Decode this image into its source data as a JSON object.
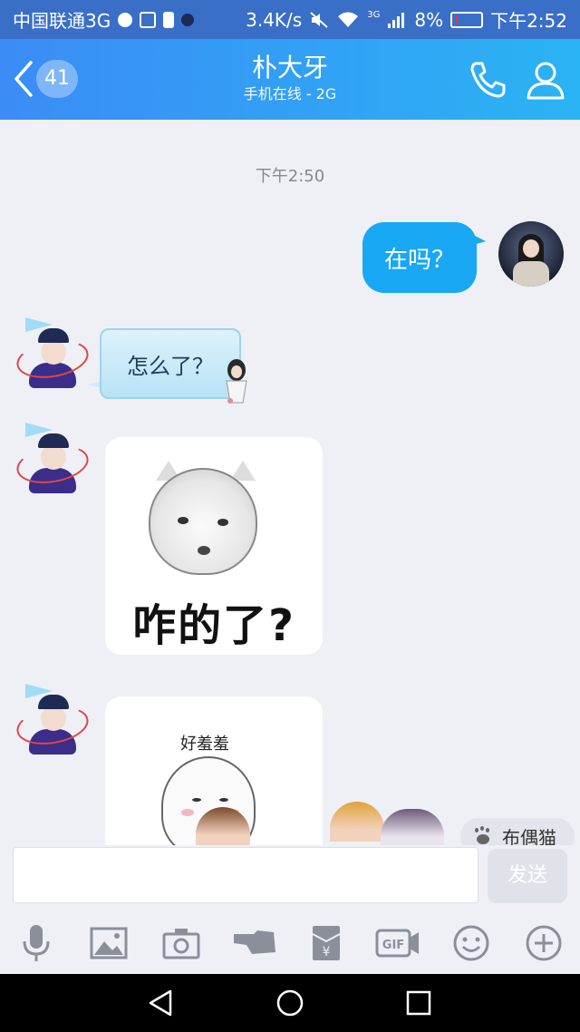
{
  "statusbar": {
    "carrier": "中国联通3G",
    "speed": "3.4K/s",
    "signal_badge": "3G",
    "battery_pct": "8%",
    "time": "下午2:52"
  },
  "header": {
    "unread_count": "41",
    "contact_name": "朴大牙",
    "status": "手机在线 - 2G"
  },
  "chat": {
    "time_label": "下午2:50",
    "messages": [
      {
        "from": "me",
        "text": "在吗？"
      },
      {
        "from": "other",
        "text": "怎么了？"
      },
      {
        "from": "other",
        "sticker_text": "咋的了?"
      },
      {
        "from": "other",
        "sticker_text": "好羞羞"
      }
    ],
    "suggestion": "布偶猫"
  },
  "input": {
    "value": "",
    "send_label": "发送"
  },
  "toolbar": {
    "icons": [
      "microphone-icon",
      "image-icon",
      "camera-icon",
      "poke-icon",
      "red-packet-icon",
      "gif-icon",
      "emoji-icon",
      "plus-icon"
    ],
    "gif_label": "GIF",
    "redpacket_glyph": "¥"
  },
  "colors": {
    "header_start": "#3b8cf5",
    "header_end": "#2ab3f4",
    "my_bubble": "#18a8f4",
    "background": "#eef0f6"
  }
}
